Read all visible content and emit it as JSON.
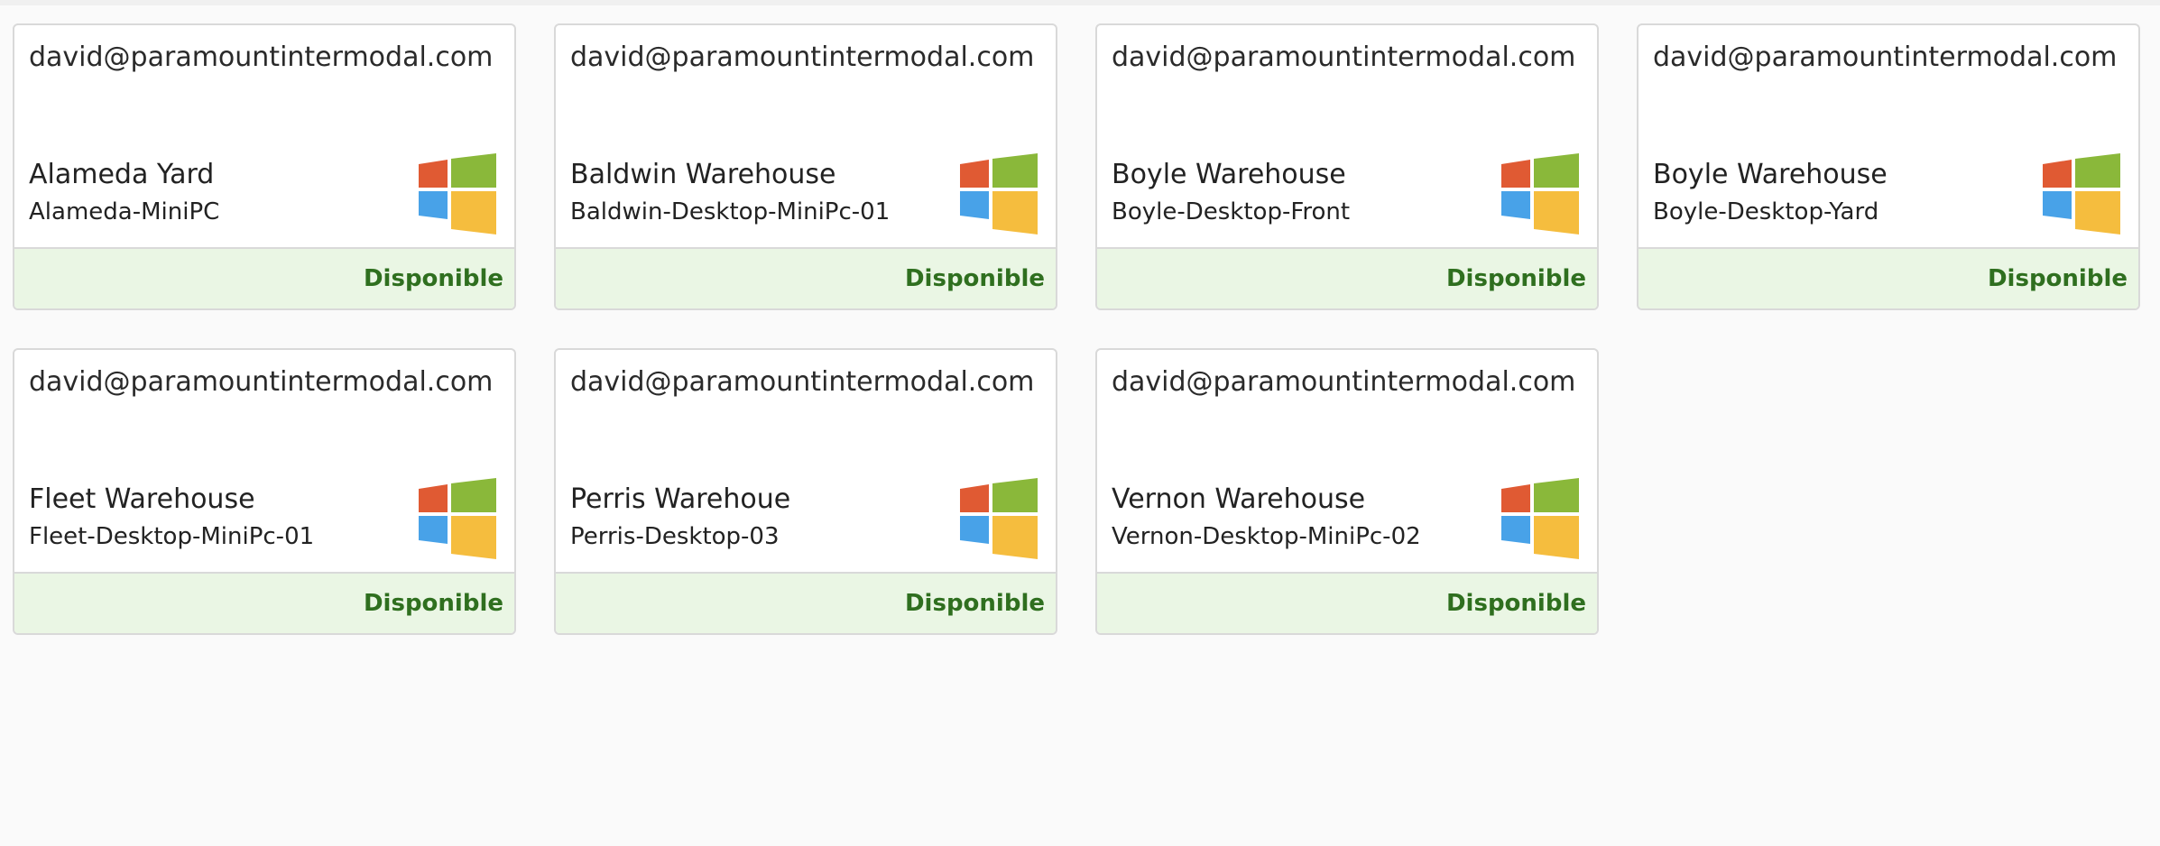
{
  "status_label": "Disponible",
  "os_icon": "windows-logo-icon",
  "colors": {
    "status_text": "#2f6f1f",
    "footer_bg": "#eaf6e4",
    "win_red": "#e05a33",
    "win_green": "#8ab83a",
    "win_blue": "#48a2e8",
    "win_yellow": "#f5bd3e"
  },
  "cards": [
    {
      "user": "david@paramountintermodal.com",
      "site": "Alameda Yard",
      "host": "Alameda-MiniPC"
    },
    {
      "user": "david@paramountintermodal.com",
      "site": "Baldwin Warehouse",
      "host": "Baldwin-Desktop-MiniPc-01"
    },
    {
      "user": "david@paramountintermodal.com",
      "site": "Boyle Warehouse",
      "host": "Boyle-Desktop-Front"
    },
    {
      "user": "david@paramountintermodal.com",
      "site": "Boyle Warehouse",
      "host": "Boyle-Desktop-Yard"
    },
    {
      "user": "david@paramountintermodal.com",
      "site": "Fleet Warehouse",
      "host": "Fleet-Desktop-MiniPc-01"
    },
    {
      "user": "david@paramountintermodal.com",
      "site": "Perris Warehoue",
      "host": "Perris-Desktop-03"
    },
    {
      "user": "david@paramountintermodal.com",
      "site": "Vernon Warehouse",
      "host": "Vernon-Desktop-MiniPc-02"
    }
  ]
}
